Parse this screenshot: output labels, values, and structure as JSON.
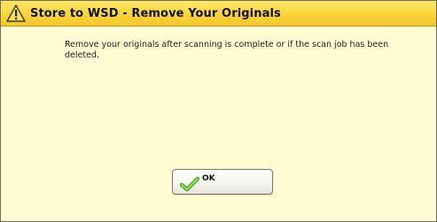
{
  "dialog": {
    "title": "Store to WSD - Remove Your Originals",
    "title_icon": "warning-icon",
    "message": "Remove your originals after scanning is complete or if the scan job has been deleted.",
    "ok_button": {
      "label": "OK",
      "icon": "checkmark-icon"
    }
  },
  "colors": {
    "title_bar": "#f7d43c",
    "dialog_background": "#fffcd3",
    "checkmark": "#6cc63c"
  }
}
